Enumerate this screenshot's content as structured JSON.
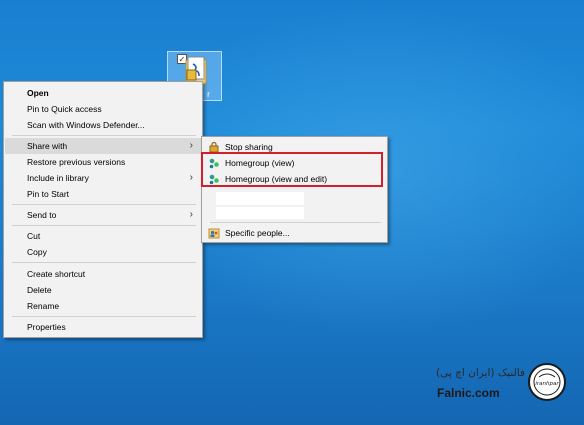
{
  "desktop": {
    "file_label": "r",
    "file_checked": "✓"
  },
  "context_menu": {
    "items": [
      {
        "label": "Open"
      },
      {
        "label": "Pin to Quick access"
      },
      {
        "label": "Scan with Windows Defender..."
      },
      {
        "label": "Share with"
      },
      {
        "label": "Restore previous versions"
      },
      {
        "label": "Include in library"
      },
      {
        "label": "Pin to Start"
      },
      {
        "label": "Send to"
      },
      {
        "label": "Cut"
      },
      {
        "label": "Copy"
      },
      {
        "label": "Create shortcut"
      },
      {
        "label": "Delete"
      },
      {
        "label": "Rename"
      },
      {
        "label": "Properties"
      }
    ],
    "submenu_arrow": "›"
  },
  "share_submenu": {
    "items": [
      {
        "label": "Stop sharing",
        "icon": "lock-icon"
      },
      {
        "label": "Homegroup (view)",
        "icon": "homegroup-icon"
      },
      {
        "label": "Homegroup (view and edit)",
        "icon": "homegroup-icon"
      },
      {
        "label": "Specific people...",
        "icon": "people-icon"
      }
    ]
  },
  "watermark": {
    "brand": "Falnic.com",
    "persian_text": "فالنیک (ایران اچ پی)",
    "badge_text": "iranhpar"
  },
  "colors": {
    "desktop_blue": "#1a7fd0",
    "menu_bg": "#f2f2f2",
    "highlight_red": "#d11f2f",
    "homegroup_teal": "#2a9d8f"
  }
}
